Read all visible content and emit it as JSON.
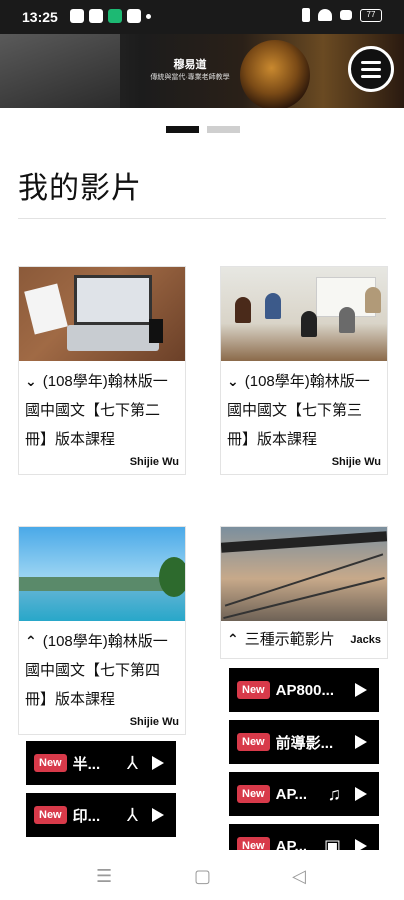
{
  "status_bar": {
    "time": "13:25",
    "battery": "77"
  },
  "banner": {
    "title": "穆易道",
    "subtitle": "傳統與當代·專業老師教學"
  },
  "page": {
    "title": "我的影片"
  },
  "cards": [
    {
      "chevron": "⌄",
      "title": "(108學年)翰林版一國中國文【七下第二冊】版本課程",
      "author": "Shijie Wu",
      "thumbnail": "laptop-desk"
    },
    {
      "chevron": "⌄",
      "title": "(108學年)翰林版一國中國文【七下第三冊】版本課程",
      "author": "Shijie Wu",
      "thumbnail": "classroom"
    },
    {
      "chevron": "⌃",
      "title": "(108學年)翰林版一國中國文【七下第四冊】版本課程",
      "author": "Shijie Wu",
      "thumbnail": "pool"
    },
    {
      "chevron": "⌃",
      "title": "三種示範影片",
      "author": "Jacks",
      "thumbnail": "sky-chain"
    }
  ],
  "left_videos": [
    {
      "badge": "New",
      "title": "半...",
      "type_icon": "pdf-icon",
      "icon_glyph": "⅄"
    },
    {
      "badge": "New",
      "title": "印...",
      "type_icon": "pdf-icon",
      "icon_glyph": "⅄"
    }
  ],
  "right_videos": [
    {
      "badge": "New",
      "title": "AP800...",
      "type_icon": "",
      "icon_glyph": ""
    },
    {
      "badge": "New",
      "title": "前導影...",
      "type_icon": "",
      "icon_glyph": ""
    },
    {
      "badge": "New",
      "title": "AP...",
      "type_icon": "music-icon",
      "icon_glyph": "♫"
    },
    {
      "badge": "New",
      "title": "AP...",
      "type_icon": "document-icon",
      "icon_glyph": "▣"
    }
  ],
  "colors": {
    "badge_red": "#d83a4a",
    "item_bg": "#000000"
  }
}
